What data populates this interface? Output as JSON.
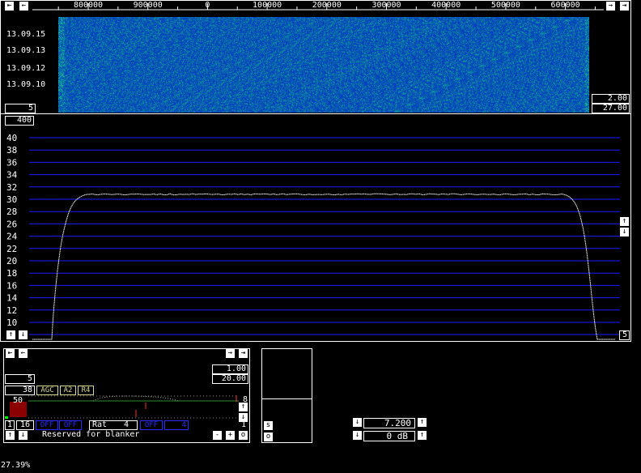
{
  "waterfall": {
    "freq_ticks": [
      "800000",
      "900000",
      "0",
      "100000",
      "200000",
      "300000",
      "400000",
      "500000",
      "600000"
    ],
    "time_labels": [
      "13.09.15",
      "13.09.13",
      "13.09.12",
      "13.09.10"
    ],
    "avg_value": "5",
    "gain_value": "2.00",
    "zero_value": "27.00"
  },
  "spectrum": {
    "height_value": "400",
    "y_ticks": [
      "40",
      "38",
      "36",
      "34",
      "32",
      "30",
      "28",
      "26",
      "24",
      "22",
      "20",
      "18",
      "16",
      "14",
      "12",
      "10"
    ],
    "right_value": "5",
    "level": 30.8,
    "trace_color": "#ffffff",
    "grid_color": "#1c1cff"
  },
  "baseband": {
    "value_5": "5",
    "value_1": "1.00",
    "value_20": "20.00",
    "value_38": "38",
    "agc": "AGC",
    "a2": "A2",
    "r4": "R4",
    "s_meter_value": "50",
    "right_8": "8",
    "right_1": "1",
    "val_1": "1",
    "val_16": "16",
    "off1": "OFF",
    "off2": "OFF",
    "rat_label": "Rat",
    "rat_value": "4",
    "off3": "OFF",
    "val_4": "4",
    "blanker_text": "Reserved for blanker",
    "minus": "-",
    "plus": "+",
    "o": "o"
  },
  "s_box": {
    "s": "s",
    "o": "o"
  },
  "freq_control": {
    "value": "7.200",
    "db": "0 dB"
  },
  "status": {
    "cpu": "27.39%"
  }
}
